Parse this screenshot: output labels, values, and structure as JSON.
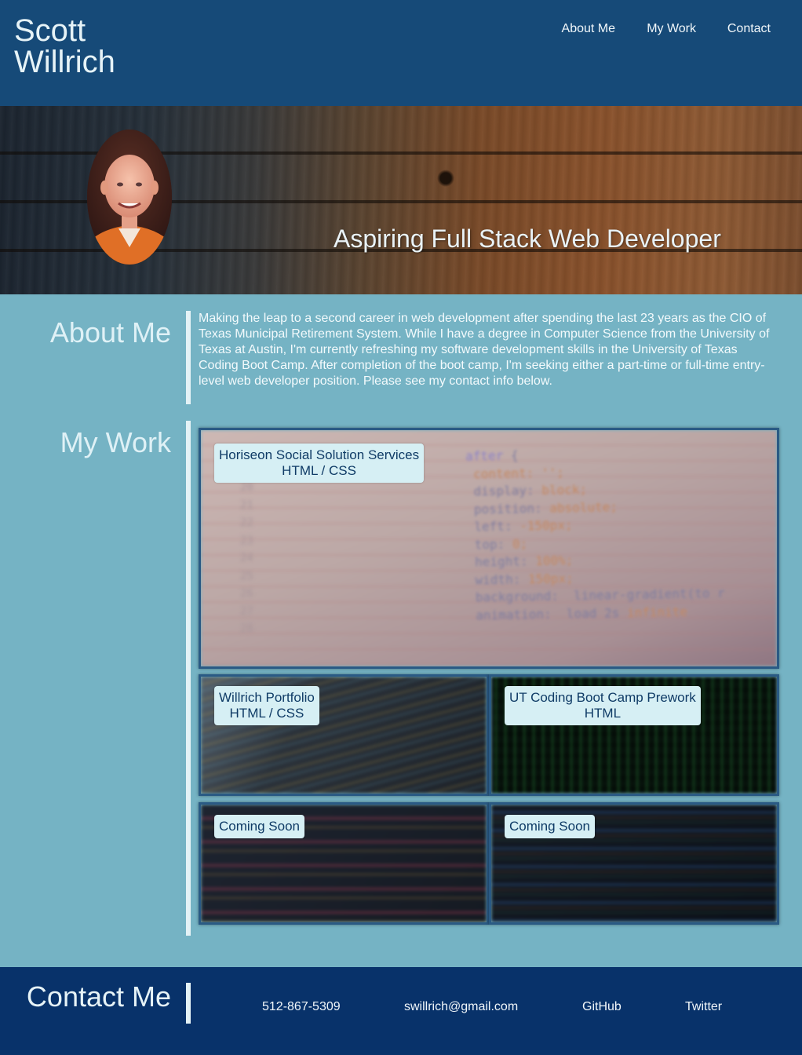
{
  "header": {
    "name_line1": "Scott",
    "name_line2": "Willrich",
    "nav": [
      "About Me",
      "My Work",
      "Contact"
    ]
  },
  "hero": {
    "tagline": "Aspiring Full Stack Web Developer"
  },
  "about": {
    "title": "About Me",
    "text": "Making the leap to a second career in web development after spending the last 23 years as the CIO of Texas Municipal Retirement System. While I have a degree in Computer Science from the University of Texas at Austin, I'm currently refreshing my software development skills in the University of Texas Coding Boot Camp. After completion of the boot camp, I'm seeking either a part-time or full-time entry-level web developer position. Please see my contact info below."
  },
  "work": {
    "title": "My Work",
    "projects": [
      {
        "line1": "Horiseon Social Solution Services",
        "line2": "HTML / CSS"
      },
      {
        "line1": "Willrich Portfolio",
        "line2": "HTML / CSS"
      },
      {
        "line1": "UT Coding Boot Camp Prework",
        "line2": "HTML"
      },
      {
        "line1": "Coming Soon"
      },
      {
        "line1": "Coming Soon"
      }
    ]
  },
  "contact": {
    "title": "Contact Me",
    "phone": "512-867-5309",
    "email": "swillrich@gmail.com",
    "github": "GitHub",
    "twitter": "Twitter"
  },
  "colors": {
    "header_bg": "#164a78",
    "page_bg": "#75b3c4",
    "footer_bg": "#08326a",
    "label_bg": "#d6eff4",
    "label_text": "#0f3b66"
  }
}
